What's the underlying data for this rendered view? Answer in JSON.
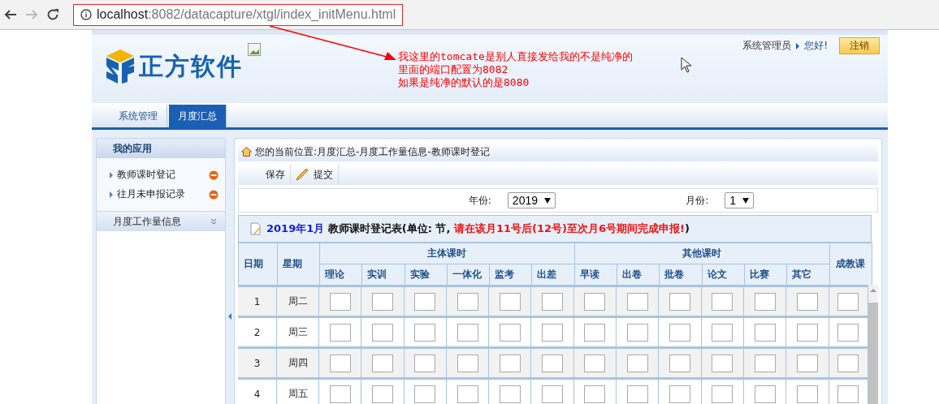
{
  "browser": {
    "host": "localhost",
    "path": ":8082/datacapture/xtgl/index_initMenu.html"
  },
  "annotation": {
    "lines": [
      "我这里的tomcate是别人直接发给我的不是纯净的",
      "里面的端口配置为8082",
      "如果是纯净的默认的是8080"
    ]
  },
  "header": {
    "logo_text": "正方软件",
    "user": "系统管理员",
    "greeting": "您好!",
    "logout": "注销"
  },
  "nav_tabs": [
    {
      "label": "系统管理",
      "selected": false
    },
    {
      "label": "月度汇总",
      "selected": true
    }
  ],
  "sidebar": {
    "title": "我的应用",
    "items": [
      {
        "label": "教师课时登记"
      },
      {
        "label": "往月未申报记录"
      }
    ],
    "section": "月度工作量信息"
  },
  "breadcrumb": "您的当前位置:月度汇总-月度工作量信息-教师课时登记",
  "toolbar": [
    {
      "label": "保存",
      "kind": "plain"
    },
    {
      "label": "提交",
      "kind": "pencil"
    }
  ],
  "filters": [
    {
      "label": "年份:",
      "value": "2019"
    },
    {
      "label": "月份:",
      "value": "1"
    }
  ],
  "table": {
    "title": {
      "period": "2019年1月",
      "name": "教师课时登记表(单位: 节,",
      "notice": "请在该月11号后(12号)至次月6号期间完成申报!",
      "close": ")"
    },
    "date_column": "日期",
    "weekday_column": "星期",
    "groups": [
      {
        "label": "主体课时",
        "columns": [
          "理论",
          "实训",
          "实验",
          "一体化",
          "监考",
          "出差"
        ]
      },
      {
        "label": "其他课时",
        "columns": [
          "早读",
          "出卷",
          "批卷",
          "论文",
          "比赛",
          "其它"
        ]
      }
    ],
    "last_column": "成教课",
    "rows": [
      {
        "date": "1",
        "weekday": "周二"
      },
      {
        "date": "2",
        "weekday": "周三"
      },
      {
        "date": "3",
        "weekday": "周四"
      },
      {
        "date": "4",
        "weekday": "周五"
      }
    ]
  }
}
